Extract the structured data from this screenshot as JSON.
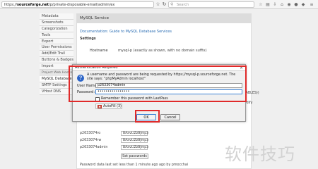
{
  "browser": {
    "url_prefix": "https://",
    "url_host": "sourceforge.net",
    "url_path": "/p/private-disposable-email/admin/ex",
    "search_placeholder": "Search"
  },
  "sidebar": {
    "items": [
      "Metadata",
      "Screenshots",
      "Categorization",
      "Tools",
      "Export",
      "User Permissions",
      "Add/Edit Trail",
      "Buttons & Badges",
      "Import"
    ],
    "section_header": "Project Web Hosting",
    "sub_items": [
      "MySQL Database",
      "SMTP Settings",
      "VHost DNS"
    ]
  },
  "main": {
    "title": "MySQL Service",
    "doc_link": "Documentation: Guide to MySQL Database Services",
    "settings_header": "Settings",
    "hostname_label": "Hostname",
    "hostname_value": "mysql-p (exactly as shown, with no domain suffix)",
    "peek_right": "CK TABLES))",
    "peek_right2": "modify",
    "pw_rows": [
      {
        "label": "p2633074ro",
        "value": "BAavLiZzBJmp3"
      },
      {
        "label": "p2633074rw",
        "value": "BAavLiZzBJmp3"
      },
      {
        "label": "p2633074admin",
        "value": "BAavLiZzBJmp3"
      }
    ],
    "set_passwords_label": "Set passwords",
    "footer_note": "Password data last set less than 1 minute ago ago by pmocchai"
  },
  "dialog": {
    "title": "Authentication Required",
    "close_glyph": "×",
    "message": "A username and password are being requested by https://mysql-p.sourceforge.net. The site says: \"phpMyAdmin localhost\"",
    "user_label": "User Name:",
    "user_value": "p2633074admin",
    "password_label": "Password:",
    "password_value": "••••••••••••••••",
    "remember_label": "Remember this password with LastPass",
    "autofill_label": "AutoFill (3)",
    "ok_label": "OK",
    "cancel_label": "Cancel"
  },
  "watermark": "软件技巧",
  "colors": {
    "highlight": "#e02a2a",
    "link": "#2a6db3",
    "info_icon": "#2b64c8"
  }
}
